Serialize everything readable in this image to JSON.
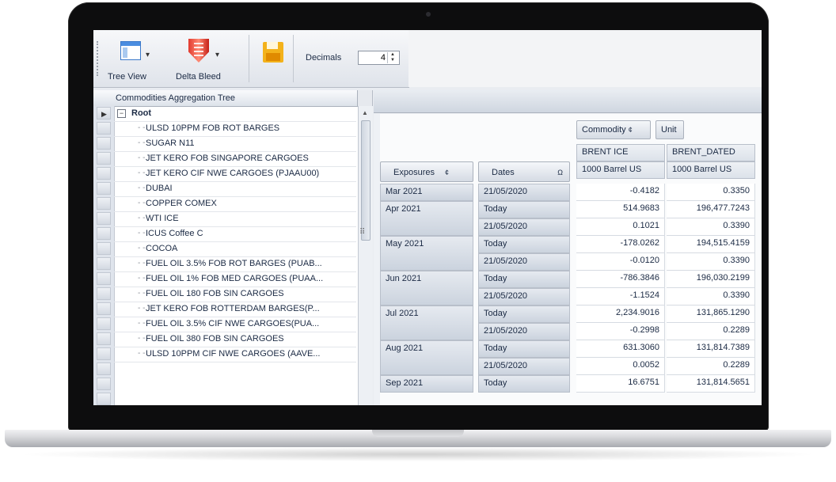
{
  "toolbar": {
    "tree_view_label": "Tree View",
    "delta_bleed_label": "Delta Bleed",
    "decimals_label": "Decimals",
    "decimals_value": "4"
  },
  "tree": {
    "header": "Commodities Aggregation Tree",
    "root": "Root",
    "items": [
      "ULSD 10PPM FOB ROT BARGES",
      "SUGAR N11",
      "JET KERO FOB SINGAPORE CARGOES",
      "JET KERO CIF NWE CARGOES (PJAAU00)",
      "DUBAI",
      "COPPER COMEX",
      "WTI ICE",
      "ICUS Coffee C",
      "COCOA",
      "FUEL OIL 3.5% FOB ROT BARGES (PUAB...",
      "FUEL OIL 1% FOB MED CARGOES (PUAA...",
      "FUEL OIL 180 FOB SIN CARGOES",
      "JET KERO FOB ROTTERDAM BARGES(P...",
      "FUEL OIL 3.5% CIF NWE CARGOES(PUA...",
      "FUEL OIL 380 FOB SIN CARGOES",
      "ULSD 10PPM CIF NWE CARGOES (AAVE..."
    ]
  },
  "pivot": {
    "commodity_field": "Commodity",
    "unit_field": "Unit",
    "exposures_field": "Exposures",
    "dates_field": "Dates",
    "columns": [
      {
        "commodity": "BRENT ICE",
        "unit": "1000 Barrel US"
      },
      {
        "commodity": "BRENT_DATED",
        "unit": "1000 Barrel US"
      }
    ],
    "rows": [
      {
        "month": "Mar 2021",
        "date": "21/05/2020",
        "v1": "-0.4182",
        "v2": "0.3350"
      },
      {
        "month": "Apr 2021",
        "date": "Today",
        "v1": "514.9683",
        "v2": "196,477.7243"
      },
      {
        "month": "",
        "date": "21/05/2020",
        "v1": "0.1021",
        "v2": "0.3390"
      },
      {
        "month": "May 2021",
        "date": "Today",
        "v1": "-178.0262",
        "v2": "194,515.4159"
      },
      {
        "month": "",
        "date": "21/05/2020",
        "v1": "-0.0120",
        "v2": "0.3390"
      },
      {
        "month": "Jun 2021",
        "date": "Today",
        "v1": "-786.3846",
        "v2": "196,030.2199"
      },
      {
        "month": "",
        "date": "21/05/2020",
        "v1": "-1.1524",
        "v2": "0.3390"
      },
      {
        "month": "Jul 2021",
        "date": "Today",
        "v1": "2,234.9016",
        "v2": "131,865.1290"
      },
      {
        "month": "",
        "date": "21/05/2020",
        "v1": "-0.2998",
        "v2": "0.2289"
      },
      {
        "month": "Aug 2021",
        "date": "Today",
        "v1": "631.3060",
        "v2": "131,814.7389"
      },
      {
        "month": "",
        "date": "21/05/2020",
        "v1": "0.0052",
        "v2": "0.2289"
      },
      {
        "month": "Sep 2021",
        "date": "Today",
        "v1": "16.6751",
        "v2": "131,814.5651"
      }
    ]
  }
}
